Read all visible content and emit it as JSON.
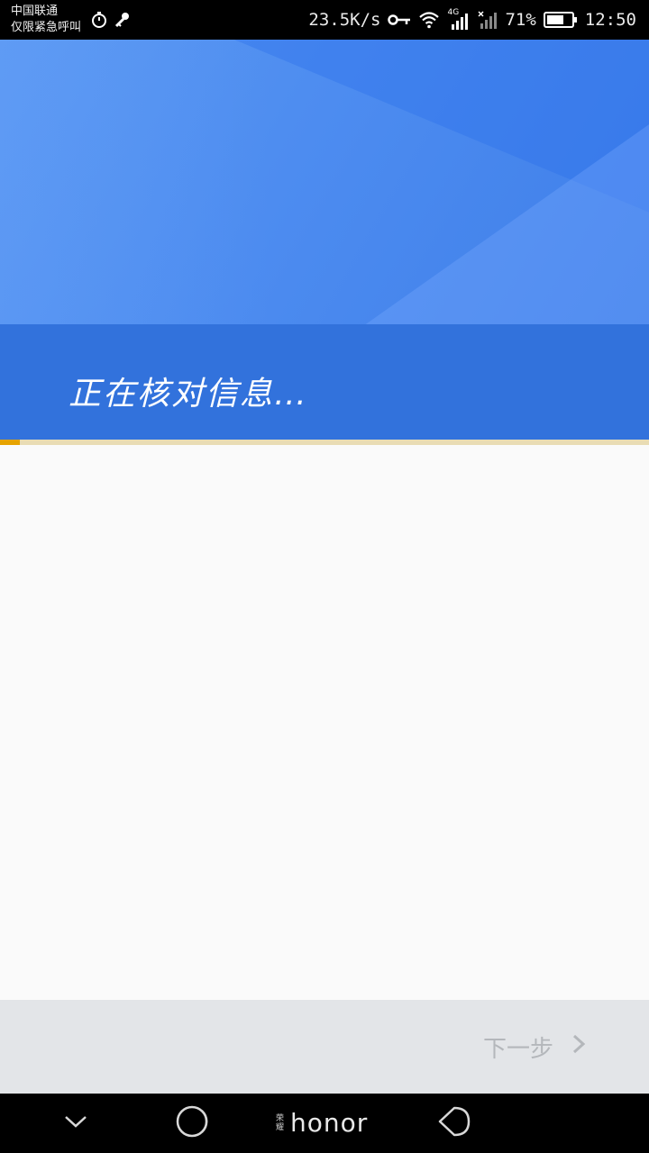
{
  "status_bar": {
    "carrier_line1": "中国联通",
    "carrier_line2": "仅限紧急呼叫",
    "network_speed": "23.5K/s",
    "network_type": "4G",
    "battery_percent": "71%",
    "battery_level": 0.71,
    "time": "12:50"
  },
  "header": {
    "status_text": "正在核对信息…",
    "progress": 0.03
  },
  "action_bar": {
    "next_label": "下一步"
  },
  "nav_bar": {
    "brand_small": "荣耀",
    "brand_name": "honor"
  },
  "colors": {
    "banner": "#3272dc",
    "progress_fill": "#e6a300",
    "action_bar": "#e3e5e8"
  }
}
